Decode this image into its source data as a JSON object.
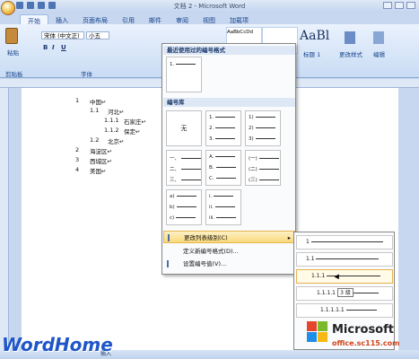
{
  "window": {
    "title": "文档 2 - Microsoft Word"
  },
  "tabs": [
    "开始",
    "插入",
    "页面布局",
    "引用",
    "邮件",
    "审阅",
    "视图",
    "加载项"
  ],
  "ribbon": {
    "paste_label": "粘贴",
    "clipboard_label": "剪贴板",
    "font_group_label": "字体",
    "font_name": "宋体 (中文正)",
    "font_size": "小五",
    "bold": "B",
    "italic": "I",
    "underline": "U",
    "style_preview": "AaBl",
    "style_name": "标题 1",
    "style_small": "AaBbCcDd",
    "change_styles": "更改样式",
    "edit": "编辑"
  },
  "document": {
    "lines": [
      {
        "num": "1",
        "text": "中国↵"
      },
      {
        "num": "1.1",
        "text": "河北↵"
      },
      {
        "num": "1.1.1",
        "text": "石家庄↵"
      },
      {
        "num": "1.1.2",
        "text": "保定↵"
      },
      {
        "num": "1.2",
        "text": "北京↵"
      },
      {
        "num": "2",
        "text": "海淀区↵"
      },
      {
        "num": "3",
        "text": "西城区↵"
      },
      {
        "num": "4",
        "text": "美国↵"
      }
    ]
  },
  "dropdown": {
    "recent_header": "最近使用过的编号格式",
    "library_header": "编号库",
    "none_label": "无",
    "recent_item": [
      "1."
    ],
    "cells": [
      [
        "1.",
        "2.",
        "3."
      ],
      [
        "1)",
        "2)",
        "3)"
      ],
      [
        "一、",
        "二、",
        "三、"
      ],
      [
        "A.",
        "B.",
        "C."
      ],
      [
        "(一)",
        "(二)",
        "(三)"
      ],
      [
        "a)",
        "b)",
        "c)"
      ],
      [
        "i.",
        "ii.",
        "iii."
      ]
    ],
    "menu": {
      "change_level": "更改列表级别(C)",
      "define_new": "定义新编号格式(D)...",
      "set_value": "设置编号值(V)..."
    }
  },
  "levels": [
    "1",
    "1.1",
    "1.1.1",
    "1.1.1.1",
    "1.1.1.1.1"
  ],
  "tooltip": "3 级",
  "statusbar": {
    "text": "插入"
  },
  "watermarks": {
    "wordhome": "WordHome",
    "microsoft": "Microsoft",
    "site": "office.sc115.com"
  },
  "colors": {
    "ribbon": "#c9dcf4",
    "highlight": "#fbd97a",
    "accent": "#15428b"
  }
}
